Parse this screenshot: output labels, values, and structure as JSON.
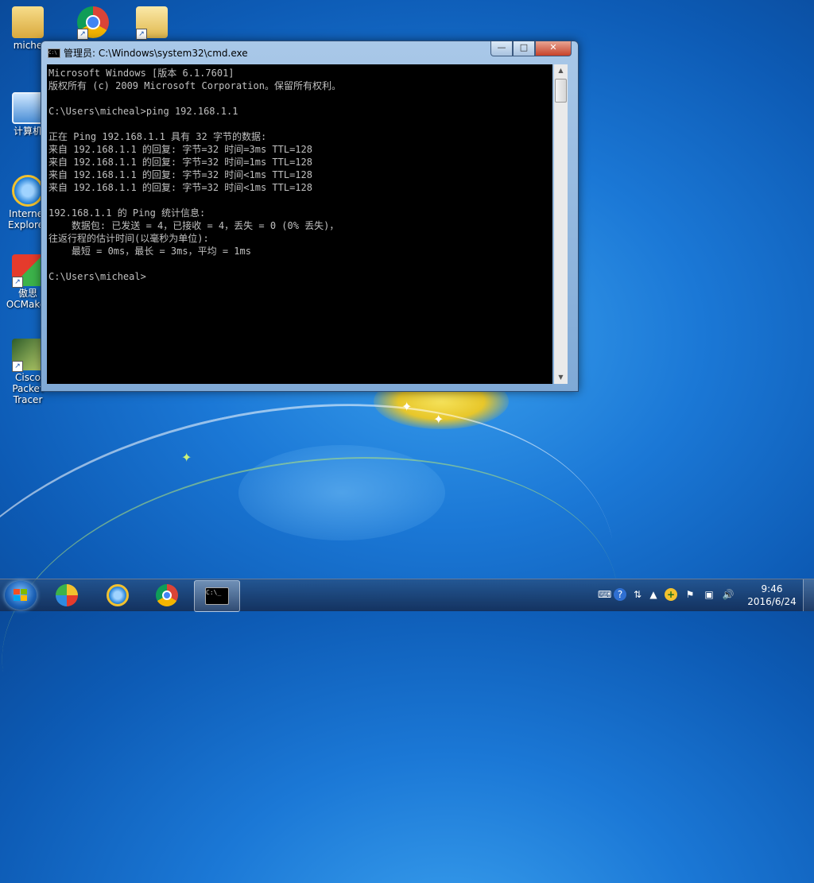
{
  "desktop": {
    "icons": [
      {
        "label": "miche",
        "name": "user-folder-icon"
      },
      {
        "label": "",
        "name": "chrome-icon"
      },
      {
        "label": "",
        "name": "folder-shortcut-icon"
      },
      {
        "label": "计算机",
        "name": "computer-icon"
      },
      {
        "label": "Internet Explorer",
        "name": "ie-icon"
      },
      {
        "label": "傲思 OCMaker",
        "name": "ocmaker-icon"
      },
      {
        "label": "Cisco Packet Tracer",
        "name": "packet-tracer-icon"
      }
    ]
  },
  "window": {
    "title": "管理员: C:\\Windows\\system32\\cmd.exe",
    "minimize": "—",
    "maximize": "□",
    "close": "✕",
    "console_lines": [
      "Microsoft Windows [版本 6.1.7601]",
      "版权所有 (c) 2009 Microsoft Corporation。保留所有权利。",
      "",
      "C:\\Users\\micheal>ping 192.168.1.1",
      "",
      "正在 Ping 192.168.1.1 具有 32 字节的数据:",
      "来自 192.168.1.1 的回复: 字节=32 时间=3ms TTL=128",
      "来自 192.168.1.1 的回复: 字节=32 时间=1ms TTL=128",
      "来自 192.168.1.1 的回复: 字节=32 时间<1ms TTL=128",
      "来自 192.168.1.1 的回复: 字节=32 时间<1ms TTL=128",
      "",
      "192.168.1.1 的 Ping 统计信息:",
      "    数据包: 已发送 = 4，已接收 = 4，丢失 = 0 (0% 丢失)，",
      "往返行程的估计时间(以毫秒为单位):",
      "    最短 = 0ms，最长 = 3ms，平均 = 1ms",
      "",
      "C:\\Users\\micheal>"
    ]
  },
  "taskbar": {
    "clock_time": "9:46",
    "clock_date": "2016/6/24",
    "buttons": [
      "start",
      "pinned-app",
      "internet-explorer",
      "chrome",
      "cmd"
    ]
  },
  "colors": {
    "console_bg": "#000000",
    "console_text": "#c0c0c0",
    "close_button": "#c7422a"
  }
}
